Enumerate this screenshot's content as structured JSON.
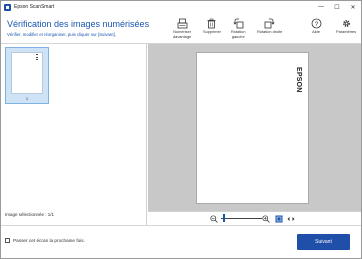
{
  "window": {
    "title": "Epson ScanSmart",
    "controls": {
      "minimize": "—",
      "maximize": "☐",
      "close": "✕"
    }
  },
  "header": {
    "title": "Vérification des images numérisées",
    "subtitle": "Vérifier, modifier et réorganiser, puis cliquer sur [Suivant]."
  },
  "toolbar": {
    "scan_more": {
      "label": "Numériser\ndavantage",
      "icon": "scanner-icon"
    },
    "delete": {
      "label": "Supprimer",
      "icon": "trash-icon"
    },
    "rotate_left": {
      "label": "Rotation\ngauche",
      "icon": "rotate-left-icon"
    },
    "rotate_right": {
      "label": "Rotation droite",
      "icon": "rotate-right-icon"
    },
    "help": {
      "label": "Aide",
      "icon": "help-icon"
    },
    "settings": {
      "label": "Paramètres",
      "icon": "gear-icon"
    }
  },
  "thumbnails": [
    {
      "number": "1",
      "selected": true
    }
  ],
  "status": {
    "selected_images": "Image sélectionnée : 1/1"
  },
  "preview": {
    "page_text": "EPSON"
  },
  "footer": {
    "skip_checkbox_label": "Passer cet écran la prochaine fois.",
    "skip_checked": false,
    "next_button": "Suivant"
  },
  "colors": {
    "accent": "#1f4fa8",
    "title_blue": "#1a56b0",
    "selection_bg": "#cfe3f7",
    "preview_bg": "#c8c8c8"
  }
}
